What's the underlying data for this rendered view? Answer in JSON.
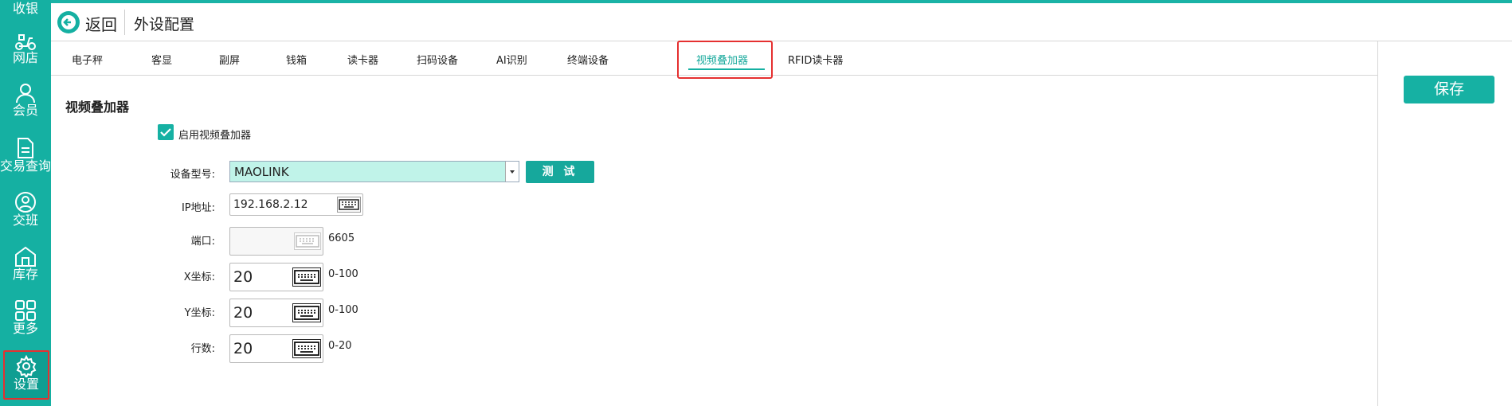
{
  "sidebar": {
    "items": [
      {
        "label": "收银",
        "icon": "cashier-icon"
      },
      {
        "label": "网店",
        "icon": "scooter-icon"
      },
      {
        "label": "会员",
        "icon": "user-icon"
      },
      {
        "label": "交易查询",
        "icon": "document-icon"
      },
      {
        "label": "交班",
        "icon": "shift-user-icon"
      },
      {
        "label": "库存",
        "icon": "warehouse-icon"
      },
      {
        "label": "更多",
        "icon": "grid-icon"
      },
      {
        "label": "设置",
        "icon": "gear-icon"
      }
    ],
    "active_index": 7
  },
  "header": {
    "back_label": "返回",
    "title": "外设配置"
  },
  "tabs": [
    "电子秤",
    "客显",
    "副屏",
    "钱箱",
    "读卡器",
    "扫码设备",
    "AI识别",
    "终端设备",
    "视频叠加器",
    "RFID读卡器"
  ],
  "active_tab": "视频叠加器",
  "save_label": "保存",
  "section_title": "视频叠加器",
  "enable": {
    "label": "启用视频叠加器",
    "checked": true
  },
  "form": {
    "device_model": {
      "label": "设备型号:",
      "value": "MAOLINK"
    },
    "test_label": "测 试",
    "ip": {
      "label": "IP地址:",
      "value": "192.168.2.12"
    },
    "port": {
      "label": "端口:",
      "value": "",
      "hint": "6605"
    },
    "x": {
      "label": "X坐标:",
      "value": "20",
      "range": "0-100"
    },
    "y": {
      "label": "Y坐标:",
      "value": "20",
      "range": "0-100"
    },
    "rows": {
      "label": "行数:",
      "value": "20",
      "range": "0-20"
    }
  },
  "colors": {
    "accent": "#15b0a2",
    "highlight": "#e53030",
    "select_bg": "#c0f3e9"
  }
}
